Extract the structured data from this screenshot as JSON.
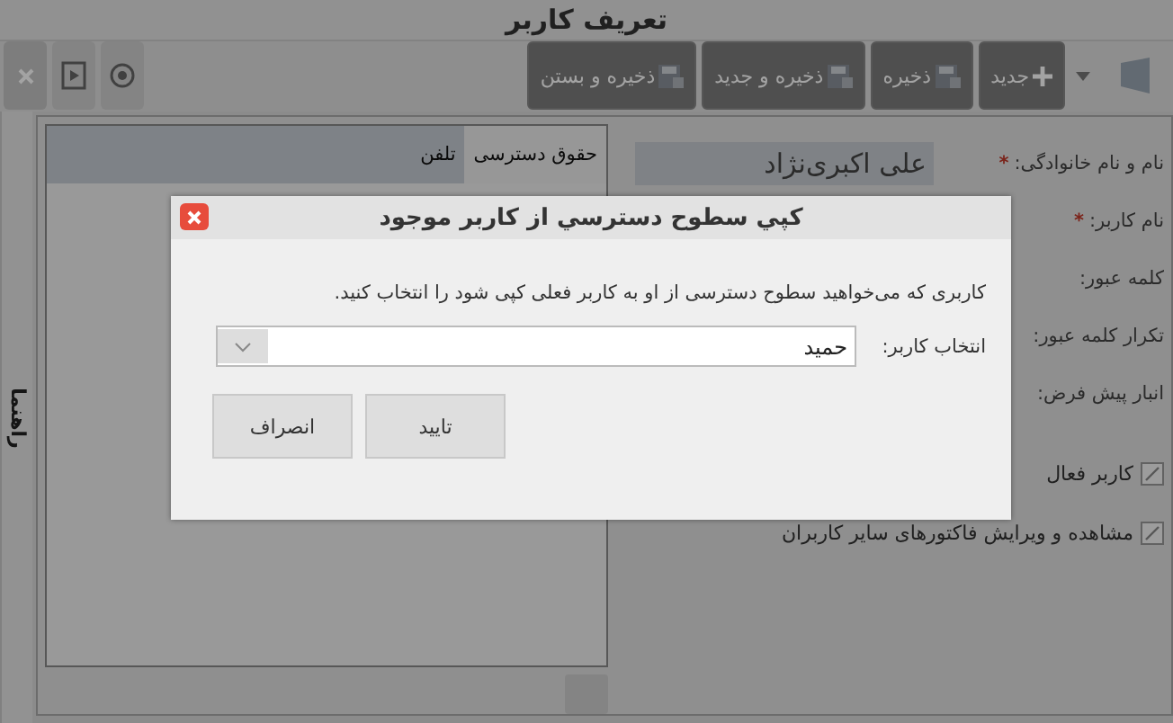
{
  "window": {
    "title": "تعریف کاربر"
  },
  "toolbar": {
    "buttons": [
      {
        "label": "جدید",
        "kind": "new"
      },
      {
        "label": "ذخیره",
        "kind": "save"
      },
      {
        "label": "ذخیره و جدید",
        "kind": "save"
      },
      {
        "label": "ذخیره و بستن",
        "kind": "save"
      }
    ]
  },
  "side_tab": {
    "label": "راهنما"
  },
  "form": {
    "fields": [
      {
        "label": "نام و نام خانوادگی:",
        "required_mark": "*",
        "value": "علی اکبری‌نژاد"
      },
      {
        "label": "نام کاربر:",
        "required_mark": "*"
      },
      {
        "label": "کلمه عبور:"
      },
      {
        "label": "تکرار کلمه عبور:"
      },
      {
        "label": "انبار پیش فرض:"
      }
    ],
    "checkboxes": [
      {
        "label": "کاربر فعال",
        "checked": true
      },
      {
        "label": "مشاهده و ویرایش فاکتورهای سایر کاربران",
        "checked": true
      }
    ]
  },
  "panel": {
    "tabs": [
      {
        "label": "حقوق دسترسی",
        "selected": true
      },
      {
        "label": "تلفن",
        "selected": false
      }
    ]
  },
  "dialog": {
    "title": "کپي سطوح دسترسي از کاربر موجود",
    "message": "کاربری که می‌خواهید سطوح دسترسی از او به کاربر فعلی کپی شود را انتخاب کنید.",
    "field": {
      "label": "انتخاب کاربر:",
      "value": "حمید"
    },
    "buttons": [
      "تایید",
      "انصراف"
    ]
  }
}
